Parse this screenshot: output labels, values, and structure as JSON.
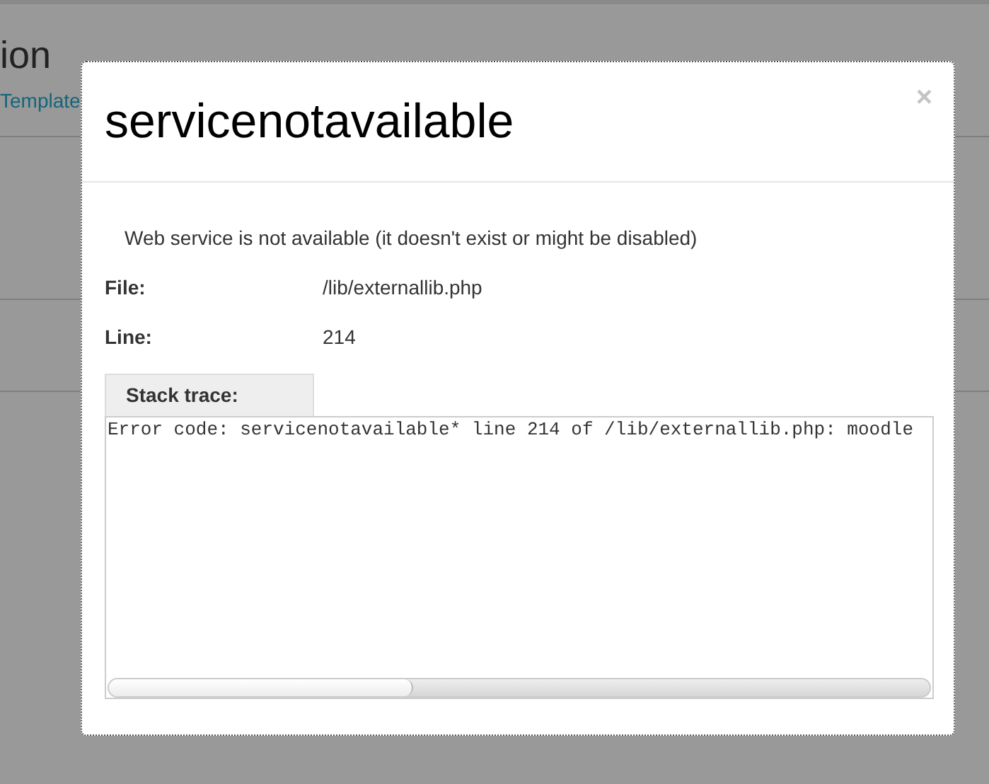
{
  "background_page": {
    "heading": "ion",
    "link": "Template"
  },
  "dialog": {
    "title": "servicenotavailable",
    "close": "×",
    "message": "Web service is not available (it doesn't exist or might be disabled)",
    "fields": [
      {
        "label": "File:",
        "value": "/lib/externallib.php"
      },
      {
        "label": "Line:",
        "value": "214"
      }
    ],
    "stack_trace": {
      "tab": "Stack trace:",
      "text": "Error code: servicenotavailable* line 214 of /lib/externallib.php: moodle"
    }
  }
}
